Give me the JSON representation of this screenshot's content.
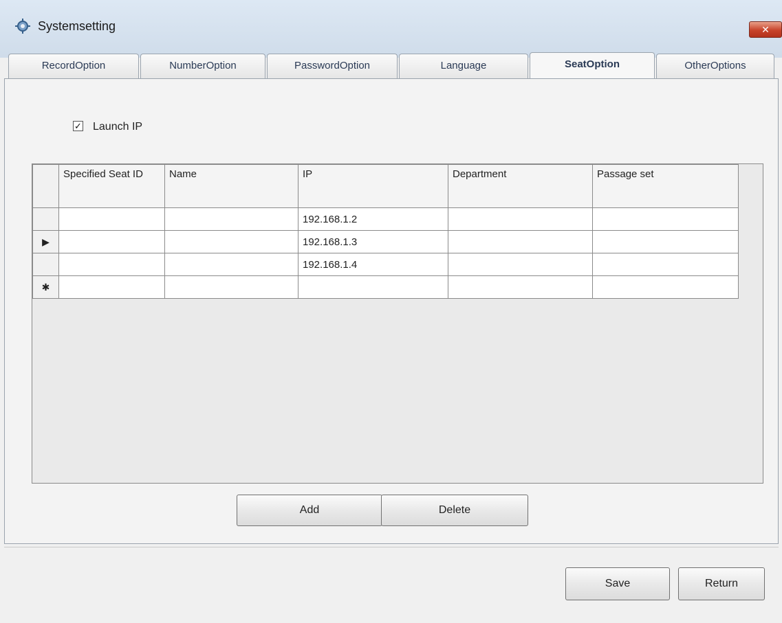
{
  "window": {
    "title": "Systemsetting",
    "close_label": "✕"
  },
  "tabs": [
    {
      "label": "RecordOption"
    },
    {
      "label": "NumberOption"
    },
    {
      "label": "PasswordOption"
    },
    {
      "label": "Language"
    },
    {
      "label": "SeatOption"
    },
    {
      "label": "OtherOptions"
    }
  ],
  "active_tab": "SeatOption",
  "launch_ip": {
    "label": "Launch IP",
    "checked": true,
    "check_mark": "✓"
  },
  "grid": {
    "columns": [
      "Specified Seat ID",
      "Name",
      "IP",
      "Department",
      "Passage set"
    ],
    "rows": [
      {
        "indicator": "",
        "cells": [
          "",
          "",
          "192.168.1.2",
          "",
          ""
        ]
      },
      {
        "indicator": "▶",
        "cells": [
          "",
          "",
          "192.168.1.3",
          "",
          ""
        ]
      },
      {
        "indicator": "",
        "cells": [
          "",
          "",
          "192.168.1.4",
          "",
          ""
        ]
      },
      {
        "indicator": "✱",
        "cells": [
          "",
          "",
          "",
          "",
          ""
        ]
      }
    ]
  },
  "buttons": {
    "add": "Add",
    "delete": "Delete",
    "save": "Save",
    "return": "Return"
  },
  "colors": {
    "titlebar": "#d6e2ef",
    "close": "#c8432a"
  }
}
